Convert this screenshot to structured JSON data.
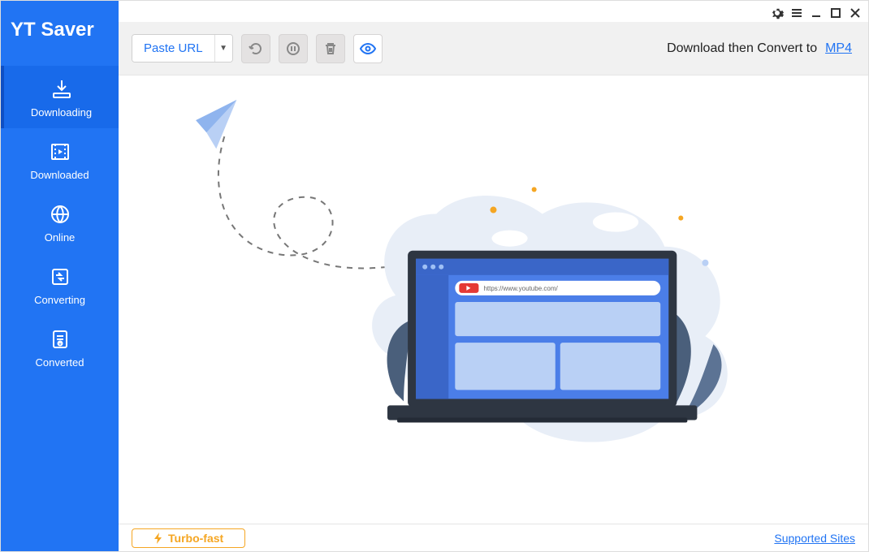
{
  "app": {
    "name": "YT Saver"
  },
  "sidebar": {
    "items": [
      {
        "label": "Downloading"
      },
      {
        "label": "Downloaded"
      },
      {
        "label": "Online"
      },
      {
        "label": "Converting"
      },
      {
        "label": "Converted"
      }
    ]
  },
  "toolbar": {
    "paste_label": "Paste URL",
    "convert_prefix": "Download then Convert to",
    "convert_format": "MP4"
  },
  "illustration": {
    "url_text": "https://www.youtube.com/"
  },
  "footer": {
    "turbo_label": "Turbo-fast",
    "supported_label": "Supported Sites"
  },
  "colors": {
    "brand_blue": "#2174f3",
    "accent_orange": "#f5a623"
  }
}
